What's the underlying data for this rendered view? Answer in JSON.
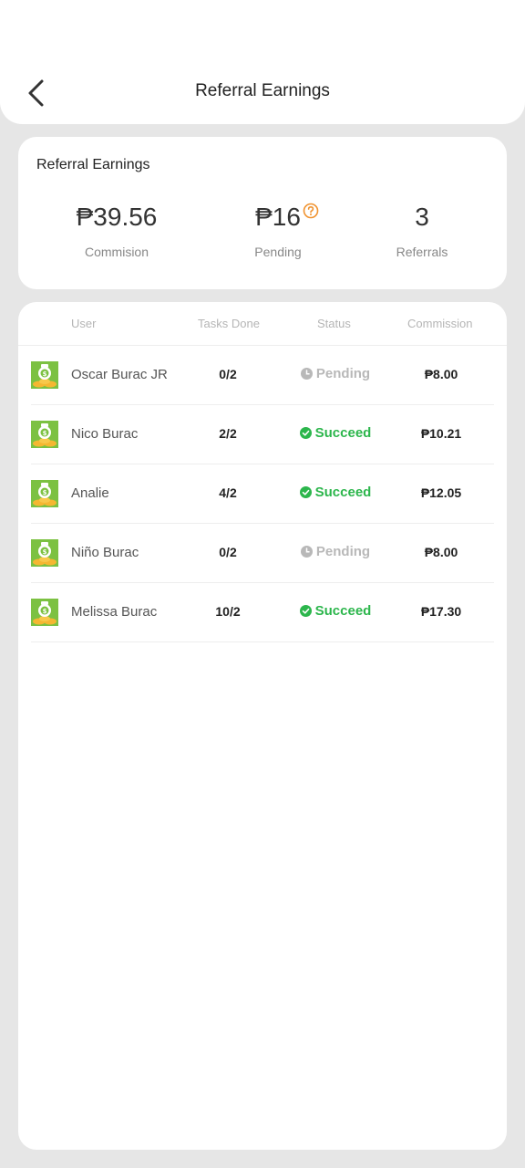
{
  "header": {
    "title": "Referral Earnings",
    "back_icon": "chevron-left-icon"
  },
  "summary": {
    "title": "Referral Earnings",
    "commission_value": "₱39.56",
    "commission_label": "Commision",
    "pending_value": "₱16",
    "pending_label": "Pending",
    "referrals_value": "3",
    "referrals_label": "Referrals",
    "help_icon": "question-circle-icon",
    "help_icon_color": "#f0922e"
  },
  "table": {
    "headers": [
      "User",
      "Tasks Done",
      "Status",
      "Commission"
    ],
    "rows": [
      {
        "user": "Oscar Burac JR",
        "tasks": "0/2",
        "status": "Pending",
        "commission": "₱8.00"
      },
      {
        "user": "Nico Burac",
        "tasks": "2/2",
        "status": "Succeed",
        "commission": "₱10.21"
      },
      {
        "user": "Analie",
        "tasks": "4/2",
        "status": "Succeed",
        "commission": "₱12.05"
      },
      {
        "user": "Niño Burac",
        "tasks": "0/2",
        "status": "Pending",
        "commission": "₱8.00"
      },
      {
        "user": "Melissa Burac",
        "tasks": "10/2",
        "status": "Succeed",
        "commission": "₱17.30"
      }
    ]
  },
  "colors": {
    "succeed": "#2cb64c",
    "pending": "#b8b8b8",
    "avatar_green": "#7cc142",
    "avatar_gold": "#f5b731"
  }
}
